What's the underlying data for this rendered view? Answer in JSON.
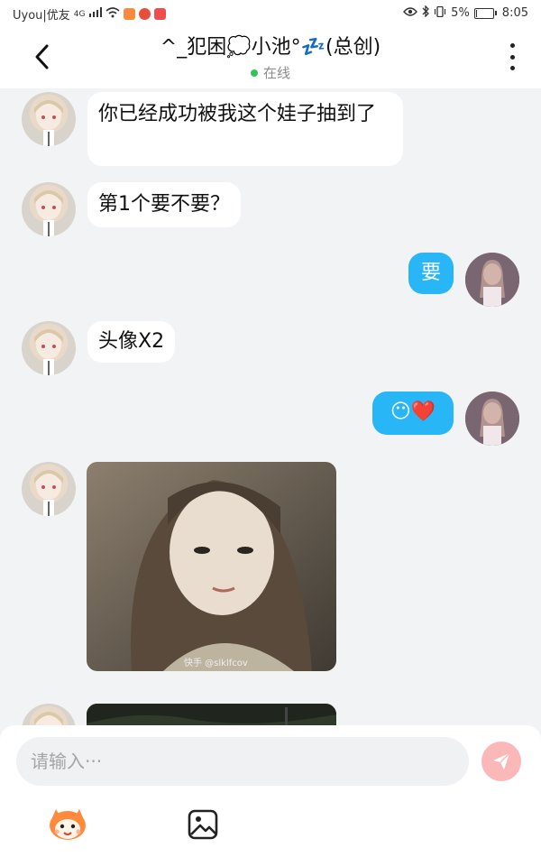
{
  "status_bar": {
    "carrier": "Uyou|优友",
    "network": "4G",
    "battery": "5%",
    "battery_level": 0.05,
    "time": "8:05"
  },
  "header": {
    "title": "^_犯困💭小池°💤(总创)",
    "status": "在线",
    "back_icon": "chevron-left-icon",
    "more_icon": "more-vertical-icon"
  },
  "messages": [
    {
      "side": "in",
      "type": "text",
      "text": "你已经成功被我这个娃子抽到了"
    },
    {
      "side": "in",
      "type": "text",
      "text": "第1个要不要？"
    },
    {
      "side": "out",
      "type": "text",
      "text": "要"
    },
    {
      "side": "in",
      "type": "text",
      "text": "头像X2"
    },
    {
      "side": "out",
      "type": "text",
      "text": "😶❤️"
    },
    {
      "side": "in",
      "type": "image",
      "caption": "快手 @slklfcov"
    },
    {
      "side": "in",
      "type": "image"
    }
  ],
  "input": {
    "placeholder": "请输入···",
    "send_icon": "paper-plane-icon"
  },
  "toolbar": {
    "sticker_icon": "mascot-sticker-icon",
    "image_icon": "image-icon"
  },
  "colors": {
    "outgoing_bubble": "#29b6f6",
    "incoming_bubble": "#ffffff",
    "background": "#f2f3f5",
    "online_dot": "#33c25a",
    "send_button": "#fbb8b8"
  }
}
